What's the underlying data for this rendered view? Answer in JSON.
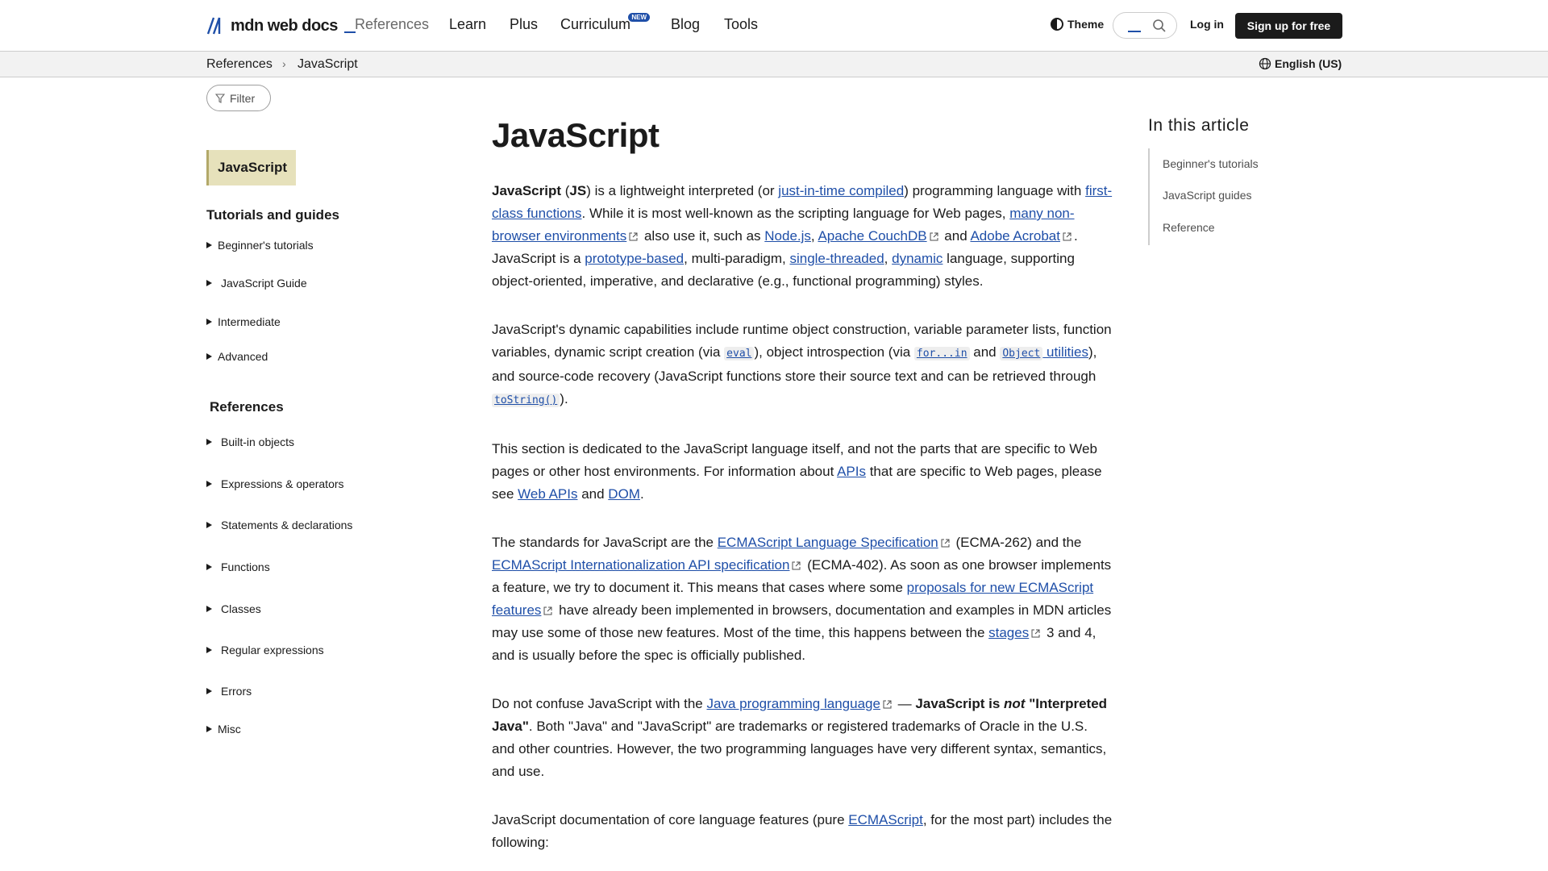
{
  "header": {
    "logo_text": "mdn web docs",
    "nav": [
      "References",
      "Learn",
      "Plus",
      "Curriculum",
      "Blog",
      "Tools"
    ],
    "new_badge": "NEW",
    "theme_label": "Theme",
    "login_label": "Log in",
    "signup_label": "Sign up for free"
  },
  "breadcrumb": {
    "items": [
      "References",
      "JavaScript"
    ],
    "separator": "›",
    "language": "English (US)"
  },
  "sidebar": {
    "filter_label": "Filter",
    "current": "JavaScript",
    "section1_title": "Tutorials and guides",
    "section1_items": [
      "Beginner's tutorials",
      "JavaScript Guide",
      "Intermediate",
      "Advanced"
    ],
    "section2_title": "References",
    "section2_items": [
      "Built-in objects",
      "Expressions & operators",
      "Statements & declarations",
      "Functions",
      "Classes",
      "Regular expressions",
      "Errors",
      "Misc"
    ]
  },
  "article": {
    "title": "JavaScript",
    "p1": {
      "b1": "JavaScript",
      "t1": " (",
      "b2": "JS",
      "t2": ") is a lightweight interpreted (or ",
      "l1": "just-in-time compiled",
      "t3": ") programming language with ",
      "l2": "first-class functions",
      "t4": ". While it is most well-known as the scripting language for Web pages, ",
      "l3": "many non-browser environments",
      "t5": " also use it, such as ",
      "l4": "Node.js",
      "t6": ", ",
      "l5": "Apache CouchDB",
      "t7": " and ",
      "l6": "Adobe Acrobat",
      "t8": ". JavaScript is a ",
      "l7": "prototype-based",
      "t9": ", multi-paradigm, ",
      "l8": "single-threaded",
      "t10": ", ",
      "l9": "dynamic",
      "t11": " language, supporting object-oriented, imperative, and declarative (e.g., functional programming) styles."
    },
    "p2": {
      "t1": "JavaScript's dynamic capabilities include runtime object construction, variable parameter lists, function variables, dynamic script creation (via ",
      "c1": "eval",
      "t2": "), object introspection (via ",
      "c2": "for...in",
      "t3": " and ",
      "c3": "Object",
      "l1": " utilities",
      "t4": "), and source-code recovery (JavaScript functions store their source text and can be retrieved through ",
      "c4": "toString()",
      "t5": ")."
    },
    "p3": {
      "t1": "This section is dedicated to the JavaScript language itself, and not the parts that are specific to Web pages or other host environments. For information about ",
      "l1": "APIs",
      "t2": " that are specific to Web pages, please see ",
      "l2": "Web APIs",
      "t3": " and ",
      "l3": "DOM",
      "t4": "."
    },
    "p4": {
      "t1": "The standards for JavaScript are the ",
      "l1": "ECMAScript Language Specification",
      "t2": " (ECMA-262) and the ",
      "l2": "ECMAScript Internationalization API specification",
      "t3": " (ECMA-402). As soon as one browser implements a feature, we try to document it. This means that cases where some ",
      "l3": "proposals for new ECMAScript features",
      "t4": " have already been implemented in browsers, documentation and examples in MDN articles may use some of those new features. Most of the time, this happens between the ",
      "l4": "stages",
      "t5": " 3 and 4, and is usually before the spec is officially published."
    },
    "p5": {
      "t1": "Do not confuse JavaScript with the ",
      "l1": "Java programming language",
      "t2": " — ",
      "b1": "JavaScript is ",
      "i1": "not",
      "b2": " \"Interpreted Java\"",
      "t3": ". Both \"Java\" and \"JavaScript\" are trademarks or registered trademarks of Oracle in the U.S. and other countries. However, the two programming languages have very different syntax, semantics, and use."
    },
    "p6": {
      "t1": "JavaScript documentation of core language features (pure ",
      "l1": "ECMAScript",
      "t2": ", for the most part) includes the following:"
    }
  },
  "toc": {
    "title": "In this article",
    "items": [
      "Beginner's tutorials",
      "JavaScript guides",
      "Reference"
    ]
  },
  "colors": {
    "link": "#1f4fa8",
    "sidebar_current_bg": "#e6e1bb",
    "signup_bg": "#1b1b1b"
  }
}
